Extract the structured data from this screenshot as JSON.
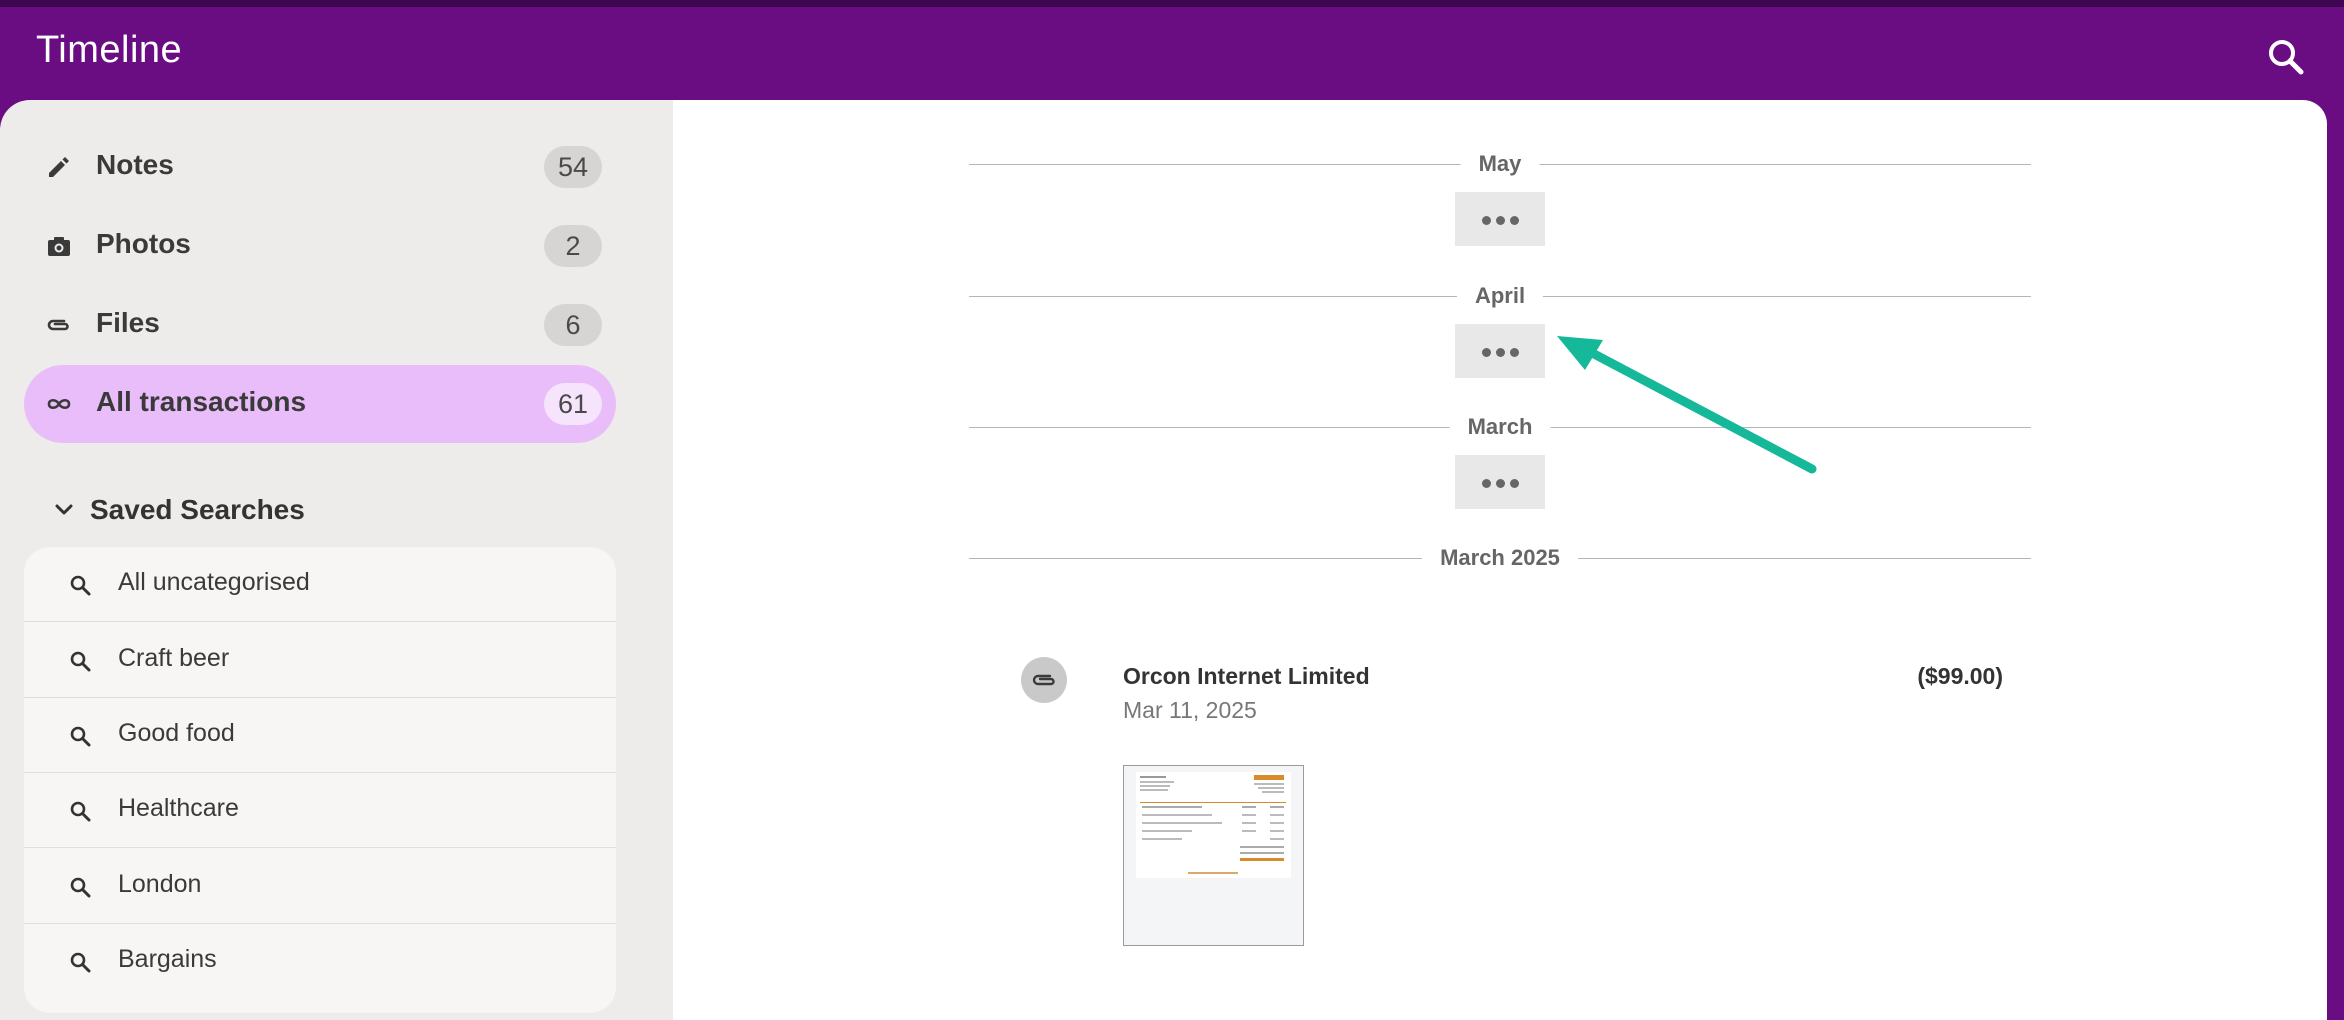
{
  "app": {
    "title": "Timeline",
    "header_color": "#6a0d83",
    "accent_color": "#e9bdf9"
  },
  "header": {
    "search_icon": "search-icon"
  },
  "sidebar": {
    "nav": [
      {
        "label": "Notes",
        "count": "54",
        "icon": "pencil-icon",
        "active": false
      },
      {
        "label": "Photos",
        "count": "2",
        "icon": "camera-icon",
        "active": false
      },
      {
        "label": "Files",
        "count": "6",
        "icon": "paperclip-icon",
        "active": false
      },
      {
        "label": "All transactions",
        "count": "61",
        "icon": "infinity-icon",
        "active": true
      }
    ],
    "saved_searches": {
      "title": "Saved Searches",
      "expanded": true,
      "items": [
        {
          "label": "All uncategorised"
        },
        {
          "label": "Craft beer"
        },
        {
          "label": "Good food"
        },
        {
          "label": "Healthcare"
        },
        {
          "label": "London"
        },
        {
          "label": "Bargains"
        }
      ]
    }
  },
  "timeline": {
    "groups": [
      {
        "label": "May",
        "collapsed": true
      },
      {
        "label": "April",
        "collapsed": true
      },
      {
        "label": "March",
        "collapsed": true
      },
      {
        "label": "March 2025",
        "collapsed": false
      }
    ],
    "annotation": {
      "type": "arrow",
      "color": "#16b89a",
      "points_to": "April expand button"
    },
    "transactions": [
      {
        "merchant": "Orcon Internet Limited",
        "date": "Mar 11, 2025",
        "amount": "($99.00)",
        "has_attachment": true,
        "attachment_kind": "invoice thumbnail"
      }
    ]
  }
}
